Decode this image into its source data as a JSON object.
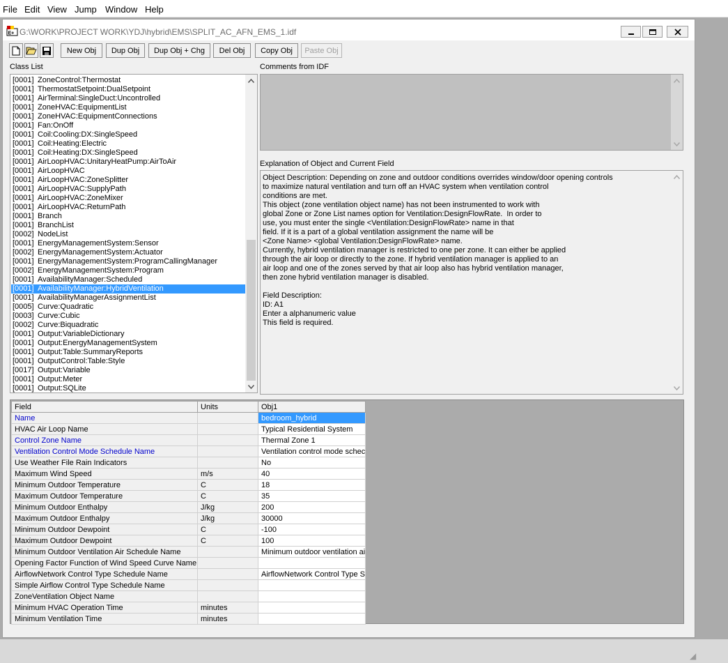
{
  "menubar": {
    "items": [
      "File",
      "Edit",
      "View",
      "Jump",
      "Window",
      "Help"
    ]
  },
  "window": {
    "title": "G:\\WORK\\PROJECT WORK\\YDJ\\hybrid\\EMS\\SPLIT_AC_AFN_EMS_1.idf"
  },
  "toolbar": {
    "icons": [
      "new-file-icon",
      "open-folder-icon",
      "save-disk-icon"
    ],
    "buttons": [
      {
        "label": "New Obj",
        "enabled": true
      },
      {
        "label": "Dup Obj",
        "enabled": true
      },
      {
        "label": "Dup Obj + Chg",
        "enabled": true
      },
      {
        "label": "Del Obj",
        "enabled": true
      },
      {
        "label": "Copy Obj",
        "enabled": true
      },
      {
        "label": "Paste Obj",
        "enabled": false
      }
    ]
  },
  "class_list": {
    "label": "Class List",
    "selected_index": 23,
    "items": [
      {
        "count": "[0001]",
        "name": "ZoneControl:Thermostat"
      },
      {
        "count": "[0001]",
        "name": "ThermostatSetpoint:DualSetpoint"
      },
      {
        "count": "[0001]",
        "name": "AirTerminal:SingleDuct:Uncontrolled"
      },
      {
        "count": "[0001]",
        "name": "ZoneHVAC:EquipmentList"
      },
      {
        "count": "[0001]",
        "name": "ZoneHVAC:EquipmentConnections"
      },
      {
        "count": "[0001]",
        "name": "Fan:OnOff"
      },
      {
        "count": "[0001]",
        "name": "Coil:Cooling:DX:SingleSpeed"
      },
      {
        "count": "[0001]",
        "name": "Coil:Heating:Electric"
      },
      {
        "count": "[0001]",
        "name": "Coil:Heating:DX:SingleSpeed"
      },
      {
        "count": "[0001]",
        "name": "AirLoopHVAC:UnitaryHeatPump:AirToAir"
      },
      {
        "count": "[0001]",
        "name": "AirLoopHVAC"
      },
      {
        "count": "[0001]",
        "name": "AirLoopHVAC:ZoneSplitter"
      },
      {
        "count": "[0001]",
        "name": "AirLoopHVAC:SupplyPath"
      },
      {
        "count": "[0001]",
        "name": "AirLoopHVAC:ZoneMixer"
      },
      {
        "count": "[0001]",
        "name": "AirLoopHVAC:ReturnPath"
      },
      {
        "count": "[0001]",
        "name": "Branch"
      },
      {
        "count": "[0001]",
        "name": "BranchList"
      },
      {
        "count": "[0002]",
        "name": "NodeList"
      },
      {
        "count": "[0001]",
        "name": "EnergyManagementSystem:Sensor"
      },
      {
        "count": "[0002]",
        "name": "EnergyManagementSystem:Actuator"
      },
      {
        "count": "[0001]",
        "name": "EnergyManagementSystem:ProgramCallingManager"
      },
      {
        "count": "[0002]",
        "name": "EnergyManagementSystem:Program"
      },
      {
        "count": "[0001]",
        "name": "AvailabilityManager:Scheduled"
      },
      {
        "count": "[0001]",
        "name": "AvailabilityManager:HybridVentilation"
      },
      {
        "count": "[0001]",
        "name": "AvailabilityManagerAssignmentList"
      },
      {
        "count": "[0005]",
        "name": "Curve:Quadratic"
      },
      {
        "count": "[0003]",
        "name": "Curve:Cubic"
      },
      {
        "count": "[0002]",
        "name": "Curve:Biquadratic"
      },
      {
        "count": "[0001]",
        "name": "Output:VariableDictionary"
      },
      {
        "count": "[0001]",
        "name": "Output:EnergyManagementSystem"
      },
      {
        "count": "[0001]",
        "name": "Output:Table:SummaryReports"
      },
      {
        "count": "[0001]",
        "name": "OutputControl:Table:Style"
      },
      {
        "count": "[0017]",
        "name": "Output:Variable"
      },
      {
        "count": "[0001]",
        "name": "Output:Meter"
      },
      {
        "count": "[0001]",
        "name": "Output:SQLite"
      }
    ]
  },
  "comments": {
    "label": "Comments from IDF",
    "text": ""
  },
  "explanation": {
    "label": "Explanation of Object and Current Field",
    "text": "Object Description: Depending on zone and outdoor conditions overrides window/door opening controls\nto maximize natural ventilation and turn off an HVAC system when ventilation control\nconditions are met.\nThis object (zone ventilation object name) has not been instrumented to work with\nglobal Zone or Zone List names option for Ventilation:DesignFlowRate.  In order to\nuse, you must enter the single <Ventilation:DesignFlowRate> name in that\nfield. If it is a part of a global ventilation assignment the name will be\n<Zone Name> <global Ventilation:DesignFlowRate> name.\nCurrently, hybrid ventilation manager is restricted to one per zone. It can either be applied\nthrough the air loop or directly to the zone. If hybrid ventilation manager is applied to an\nair loop and one of the zones served by that air loop also has hybrid ventilation manager,\nthen zone hybrid ventilation manager is disabled.\n\nField Description:\nID: A1\nEnter a alphanumeric value\nThis field is required."
  },
  "grid": {
    "headers": {
      "field": "Field",
      "units": "Units",
      "obj": "Obj1"
    },
    "selected_row": 0,
    "rows": [
      {
        "field": "Name",
        "units": "",
        "value": "bedroom_hybrid",
        "required": true
      },
      {
        "field": "HVAC Air Loop Name",
        "units": "",
        "value": "Typical Residential System",
        "required": false
      },
      {
        "field": "Control Zone Name",
        "units": "",
        "value": "Thermal Zone 1",
        "required": true
      },
      {
        "field": "Ventilation Control Mode Schedule Name",
        "units": "",
        "value": "Ventilation control mode schec",
        "required": true
      },
      {
        "field": "Use Weather File Rain Indicators",
        "units": "",
        "value": "No",
        "required": false
      },
      {
        "field": "Maximum Wind Speed",
        "units": "m/s",
        "value": "40",
        "required": false
      },
      {
        "field": "Minimum Outdoor Temperature",
        "units": "C",
        "value": "18",
        "required": false
      },
      {
        "field": "Maximum Outdoor Temperature",
        "units": "C",
        "value": "35",
        "required": false
      },
      {
        "field": "Minimum Outdoor Enthalpy",
        "units": "J/kg",
        "value": "200",
        "required": false
      },
      {
        "field": "Maximum Outdoor Enthalpy",
        "units": "J/kg",
        "value": "30000",
        "required": false
      },
      {
        "field": "Minimum Outdoor Dewpoint",
        "units": "C",
        "value": "-100",
        "required": false
      },
      {
        "field": "Maximum Outdoor Dewpoint",
        "units": "C",
        "value": "100",
        "required": false
      },
      {
        "field": "Minimum Outdoor Ventilation Air Schedule Name",
        "units": "",
        "value": "Minimum outdoor ventilation ai",
        "required": false
      },
      {
        "field": "Opening Factor Function of Wind Speed Curve Name",
        "units": "",
        "value": "",
        "required": false
      },
      {
        "field": "AirflowNetwork Control Type Schedule Name",
        "units": "",
        "value": "AirflowNetwork Control Type S",
        "required": false
      },
      {
        "field": "Simple Airflow Control Type Schedule Name",
        "units": "",
        "value": "",
        "required": false
      },
      {
        "field": "ZoneVentilation Object Name",
        "units": "",
        "value": "",
        "required": false
      },
      {
        "field": "Minimum HVAC Operation Time",
        "units": "minutes",
        "value": "",
        "required": false
      },
      {
        "field": "Minimum Ventilation Time",
        "units": "minutes",
        "value": "",
        "required": false
      }
    ]
  },
  "colors": {
    "selection": "#3399ff",
    "required_field": "#0000cc",
    "mdi_background": "#ababab"
  }
}
